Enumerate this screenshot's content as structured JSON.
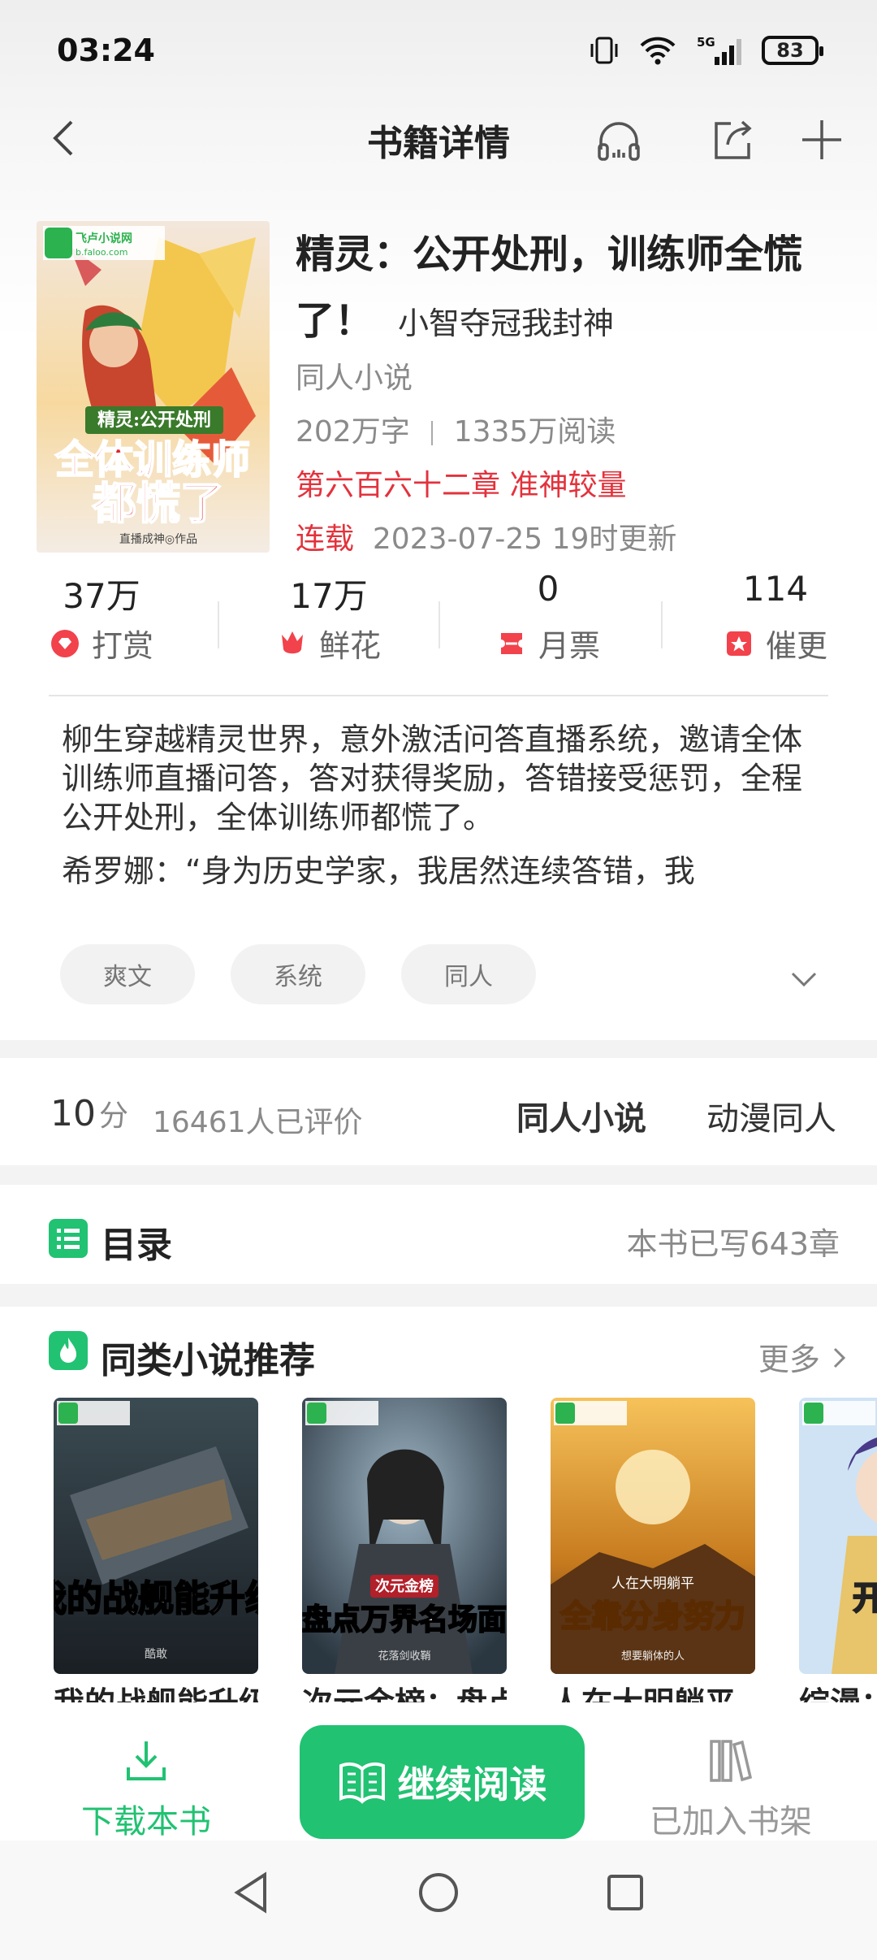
{
  "status": {
    "time": "03:24",
    "battery": "83",
    "network": "5G"
  },
  "nav": {
    "title": "书籍详情"
  },
  "book": {
    "title": "精灵：公开处刑，训练师全慌了！",
    "author": "小智夺冠我封神",
    "category": "同人小说",
    "words": "202万字",
    "reads": "1335万阅读",
    "latest_chapter": "第六百六十二章 准神较量",
    "status": "连载",
    "updated": "2023-07-25 19时更新",
    "cover_text": {
      "line1": "精灵:公开处刑",
      "line2": "全体训练师",
      "line3": "都慌了",
      "credit": "直播成神◎作品",
      "logo": "飞卢小说网",
      "logo_sub": "b.faloo.com"
    }
  },
  "stats": [
    {
      "value": "37万",
      "label": "打赏"
    },
    {
      "value": "17万",
      "label": "鲜花"
    },
    {
      "value": "0",
      "label": "月票"
    },
    {
      "value": "114",
      "label": "催更"
    }
  ],
  "intro": {
    "p1": "柳生穿越精灵世界，意外激活问答直播系统，邀请全体训练师直播问答，答对获得奖励，答错接受惩罚，全程公开处刑，全体训练师都慌了。",
    "p2": "希罗娜：“身为历史学家，我居然连续答错，我"
  },
  "tags": [
    "爽文",
    "系统",
    "同人"
  ],
  "rating": {
    "score": "10",
    "unit": "分",
    "count": "16461人已评价",
    "category1": "同人小说",
    "category2": "动漫同人"
  },
  "toc": {
    "title": "目录",
    "info": "本书已写643章"
  },
  "recommend": {
    "title": "同类小说推荐",
    "more": "更多",
    "books": [
      {
        "name": "我的战舰能升级",
        "cover_title": "我的战舰能升级",
        "cover_author": "酷敢"
      },
      {
        "name": "次元金榜：盘点万界名场面",
        "cover_badge": "次元金榜",
        "cover_title": "盘点万界名场面",
        "cover_author": "花落剑收鞘"
      },
      {
        "name": "人在大明躺平，全靠分身努力",
        "cover_top": "人在大明躺平",
        "cover_title": "全靠分身努力",
        "cover_author": "想要躺体的人"
      },
      {
        "name": "综漫：开局小...",
        "cover_title": "开局小"
      }
    ]
  },
  "bottom": {
    "download": "下载本书",
    "continue": "继续阅读",
    "shelf": "已加入书架"
  },
  "colors": {
    "accent": "#21c272",
    "red": "#e3323c"
  }
}
